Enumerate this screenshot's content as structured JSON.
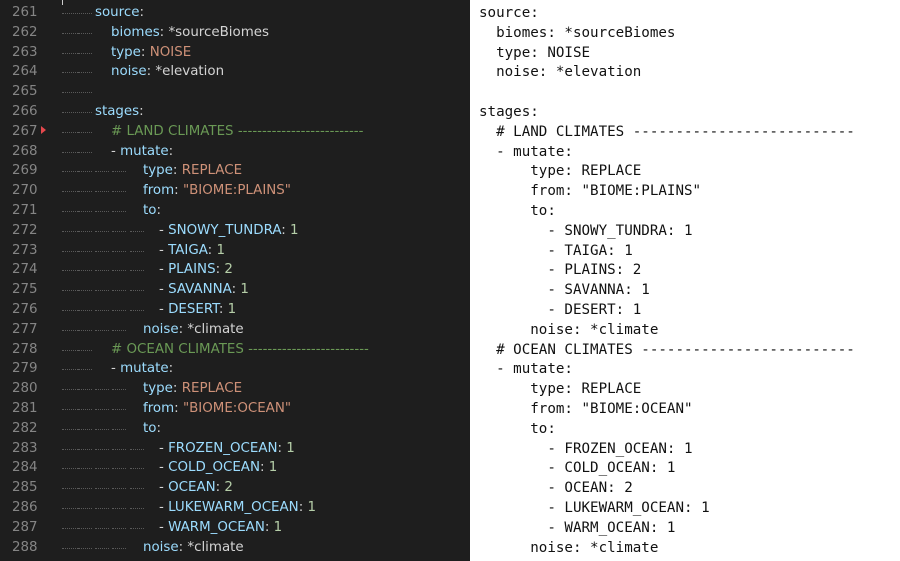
{
  "theme": {
    "editor_bg": "#1e1e1e",
    "line_number": "#858585",
    "key": "#9cdcfe",
    "punct": "#d4d4d4",
    "string": "#ce9178",
    "number": "#b5cea8",
    "comment": "#6a9955",
    "text": "#d4d4d4"
  },
  "editor": {
    "lines": [
      {
        "num": "261",
        "indent": 0,
        "tokens": [
          {
            "t": "source",
            "c": "key"
          },
          {
            "t": ":",
            "c": "punct"
          }
        ]
      },
      {
        "num": "262",
        "indent": 1,
        "tokens": [
          {
            "t": "biomes",
            "c": "key"
          },
          {
            "t": ": ",
            "c": "punct"
          },
          {
            "t": "*sourceBiomes",
            "c": "text"
          }
        ]
      },
      {
        "num": "263",
        "indent": 1,
        "tokens": [
          {
            "t": "type",
            "c": "key"
          },
          {
            "t": ": ",
            "c": "punct"
          },
          {
            "t": "NOISE",
            "c": "string"
          }
        ]
      },
      {
        "num": "264",
        "indent": 1,
        "tokens": [
          {
            "t": "noise",
            "c": "key"
          },
          {
            "t": ": ",
            "c": "punct"
          },
          {
            "t": "*elevation",
            "c": "text"
          }
        ]
      },
      {
        "num": "265",
        "indent": 0,
        "tokens": []
      },
      {
        "num": "266",
        "indent": 0,
        "tokens": [
          {
            "t": "stages",
            "c": "key"
          },
          {
            "t": ":",
            "c": "punct"
          }
        ]
      },
      {
        "num": "267",
        "indent": 1,
        "tokens": [
          {
            "t": "# LAND CLIMATES --------------------------",
            "c": "comment"
          }
        ]
      },
      {
        "num": "268",
        "indent": 1,
        "tokens": [
          {
            "t": "- ",
            "c": "punct"
          },
          {
            "t": "mutate",
            "c": "key"
          },
          {
            "t": ":",
            "c": "punct"
          }
        ]
      },
      {
        "num": "269",
        "indent": 3,
        "tokens": [
          {
            "t": "type",
            "c": "key"
          },
          {
            "t": ": ",
            "c": "punct"
          },
          {
            "t": "REPLACE",
            "c": "string"
          }
        ]
      },
      {
        "num": "270",
        "indent": 3,
        "tokens": [
          {
            "t": "from",
            "c": "key"
          },
          {
            "t": ": ",
            "c": "punct"
          },
          {
            "t": "\"BIOME:PLAINS\"",
            "c": "string"
          }
        ]
      },
      {
        "num": "271",
        "indent": 3,
        "tokens": [
          {
            "t": "to",
            "c": "key"
          },
          {
            "t": ":",
            "c": "punct"
          }
        ]
      },
      {
        "num": "272",
        "indent": 4,
        "tokens": [
          {
            "t": "- ",
            "c": "punct"
          },
          {
            "t": "SNOWY_TUNDRA",
            "c": "key"
          },
          {
            "t": ": ",
            "c": "punct"
          },
          {
            "t": "1",
            "c": "number"
          }
        ]
      },
      {
        "num": "273",
        "indent": 4,
        "tokens": [
          {
            "t": "- ",
            "c": "punct"
          },
          {
            "t": "TAIGA",
            "c": "key"
          },
          {
            "t": ": ",
            "c": "punct"
          },
          {
            "t": "1",
            "c": "number"
          }
        ]
      },
      {
        "num": "274",
        "indent": 4,
        "tokens": [
          {
            "t": "- ",
            "c": "punct"
          },
          {
            "t": "PLAINS",
            "c": "key"
          },
          {
            "t": ": ",
            "c": "punct"
          },
          {
            "t": "2",
            "c": "number"
          }
        ]
      },
      {
        "num": "275",
        "indent": 4,
        "tokens": [
          {
            "t": "- ",
            "c": "punct"
          },
          {
            "t": "SAVANNA",
            "c": "key"
          },
          {
            "t": ": ",
            "c": "punct"
          },
          {
            "t": "1",
            "c": "number"
          }
        ]
      },
      {
        "num": "276",
        "indent": 4,
        "tokens": [
          {
            "t": "- ",
            "c": "punct"
          },
          {
            "t": "DESERT",
            "c": "key"
          },
          {
            "t": ": ",
            "c": "punct"
          },
          {
            "t": "1",
            "c": "number"
          }
        ]
      },
      {
        "num": "277",
        "indent": 3,
        "tokens": [
          {
            "t": "noise",
            "c": "key"
          },
          {
            "t": ": ",
            "c": "punct"
          },
          {
            "t": "*climate",
            "c": "text"
          }
        ]
      },
      {
        "num": "278",
        "indent": 1,
        "tokens": [
          {
            "t": "# OCEAN CLIMATES -------------------------",
            "c": "comment"
          }
        ]
      },
      {
        "num": "279",
        "indent": 1,
        "tokens": [
          {
            "t": "- ",
            "c": "punct"
          },
          {
            "t": "mutate",
            "c": "key"
          },
          {
            "t": ":",
            "c": "punct"
          }
        ]
      },
      {
        "num": "280",
        "indent": 3,
        "tokens": [
          {
            "t": "type",
            "c": "key"
          },
          {
            "t": ": ",
            "c": "punct"
          },
          {
            "t": "REPLACE",
            "c": "string"
          }
        ]
      },
      {
        "num": "281",
        "indent": 3,
        "tokens": [
          {
            "t": "from",
            "c": "key"
          },
          {
            "t": ": ",
            "c": "punct"
          },
          {
            "t": "\"BIOME:OCEAN\"",
            "c": "string"
          }
        ]
      },
      {
        "num": "282",
        "indent": 3,
        "tokens": [
          {
            "t": "to",
            "c": "key"
          },
          {
            "t": ":",
            "c": "punct"
          }
        ]
      },
      {
        "num": "283",
        "indent": 4,
        "tokens": [
          {
            "t": "- ",
            "c": "punct"
          },
          {
            "t": "FROZEN_OCEAN",
            "c": "key"
          },
          {
            "t": ": ",
            "c": "punct"
          },
          {
            "t": "1",
            "c": "number"
          }
        ]
      },
      {
        "num": "284",
        "indent": 4,
        "tokens": [
          {
            "t": "- ",
            "c": "punct"
          },
          {
            "t": "COLD_OCEAN",
            "c": "key"
          },
          {
            "t": ": ",
            "c": "punct"
          },
          {
            "t": "1",
            "c": "number"
          }
        ]
      },
      {
        "num": "285",
        "indent": 4,
        "tokens": [
          {
            "t": "- ",
            "c": "punct"
          },
          {
            "t": "OCEAN",
            "c": "key"
          },
          {
            "t": ": ",
            "c": "punct"
          },
          {
            "t": "2",
            "c": "number"
          }
        ]
      },
      {
        "num": "286",
        "indent": 4,
        "tokens": [
          {
            "t": "- ",
            "c": "punct"
          },
          {
            "t": "LUKEWARM_OCEAN",
            "c": "key"
          },
          {
            "t": ": ",
            "c": "punct"
          },
          {
            "t": "1",
            "c": "number"
          }
        ]
      },
      {
        "num": "287",
        "indent": 4,
        "tokens": [
          {
            "t": "- ",
            "c": "punct"
          },
          {
            "t": "WARM_OCEAN",
            "c": "key"
          },
          {
            "t": ": ",
            "c": "punct"
          },
          {
            "t": "1",
            "c": "number"
          }
        ]
      },
      {
        "num": "288",
        "indent": 3,
        "tokens": [
          {
            "t": "noise",
            "c": "key"
          },
          {
            "t": ": ",
            "c": "punct"
          },
          {
            "t": "*climate",
            "c": "text"
          }
        ]
      }
    ]
  },
  "plain": {
    "lines": [
      "source:",
      "  biomes: *sourceBiomes",
      "  type: NOISE",
      "  noise: *elevation",
      "",
      "stages:",
      "  # LAND CLIMATES --------------------------",
      "  - mutate:",
      "      type: REPLACE",
      "      from: \"BIOME:PLAINS\"",
      "      to:",
      "        - SNOWY_TUNDRA: 1",
      "        - TAIGA: 1",
      "        - PLAINS: 2",
      "        - SAVANNA: 1",
      "        - DESERT: 1",
      "      noise: *climate",
      "  # OCEAN CLIMATES -------------------------",
      "  - mutate:",
      "      type: REPLACE",
      "      from: \"BIOME:OCEAN\"",
      "      to:",
      "        - FROZEN_OCEAN: 1",
      "        - COLD_OCEAN: 1",
      "        - OCEAN: 2",
      "        - LUKEWARM_OCEAN: 1",
      "        - WARM_OCEAN: 1",
      "      noise: *climate"
    ]
  }
}
